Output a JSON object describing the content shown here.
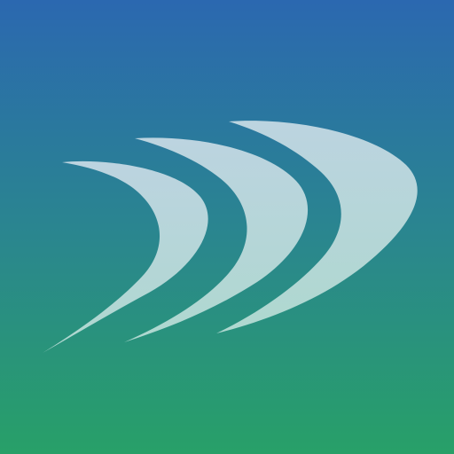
{
  "app_icon": {
    "icon": "triple-chevron-swoosh-icon",
    "colors": {
      "background_top": "#2B68B0",
      "background_mid": "#2A8590",
      "background_bottom": "#28A068",
      "chevron_light": "#BCD4E0",
      "chevron_lower": "#AED8CF"
    }
  }
}
